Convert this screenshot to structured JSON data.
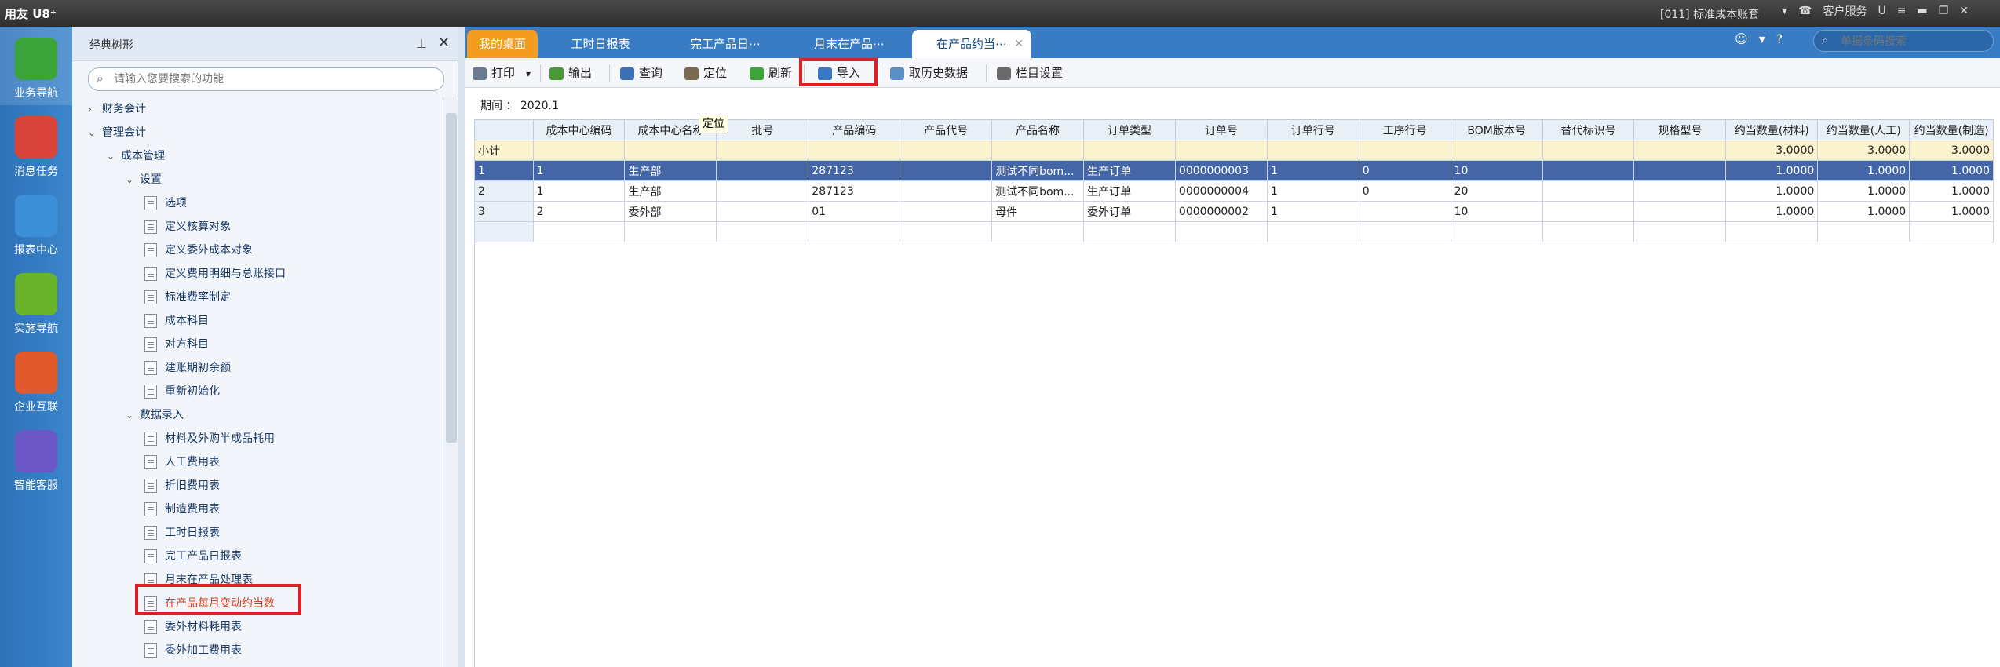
{
  "app": {
    "title": "用友 U8⁺"
  },
  "titlebar": {
    "account": "[011] 标准成本账套",
    "service": "客户服务",
    "u_icon": "U",
    "menu_icon": "≡",
    "min": "▬",
    "restore": "❐",
    "close": "✕"
  },
  "leftnav": [
    {
      "label": "业务导航",
      "icon": "business-nav-icon",
      "color": "#3aa33a"
    },
    {
      "label": "消息任务",
      "icon": "message-task-icon",
      "color": "#d9453a"
    },
    {
      "label": "报表中心",
      "icon": "report-center-icon",
      "color": "#3d8fd8"
    },
    {
      "label": "实施导航",
      "icon": "implement-nav-icon",
      "color": "#6ab42c"
    },
    {
      "label": "企业互联",
      "icon": "enterprise-link-icon",
      "color": "#e15a2c"
    },
    {
      "label": "智能客服",
      "icon": "smart-service-icon",
      "color": "#6b57c6"
    }
  ],
  "tree": {
    "title": "经典树形",
    "pin": "📌",
    "close": "✕",
    "search_placeholder": "请输入您要搜索的功能",
    "items": [
      {
        "label": "财务会计",
        "level": 0,
        "caret": "›"
      },
      {
        "label": "管理会计",
        "level": 0,
        "caret": "⌄"
      },
      {
        "label": "成本管理",
        "level": 1,
        "caret": "⌄"
      },
      {
        "label": "设置",
        "level": 2,
        "caret": "⌄"
      },
      {
        "label": "选项",
        "level": 3
      },
      {
        "label": "定义核算对象",
        "level": 3
      },
      {
        "label": "定义委外成本对象",
        "level": 3
      },
      {
        "label": "定义费用明细与总账接口",
        "level": 3
      },
      {
        "label": "标准费率制定",
        "level": 3
      },
      {
        "label": "成本科目",
        "level": 3
      },
      {
        "label": "对方科目",
        "level": 3
      },
      {
        "label": "建账期初余额",
        "level": 3
      },
      {
        "label": "重新初始化",
        "level": 3
      },
      {
        "label": "数据录入",
        "level": 2,
        "caret": "⌄"
      },
      {
        "label": "材料及外购半成品耗用",
        "level": 3
      },
      {
        "label": "人工费用表",
        "level": 3
      },
      {
        "label": "折旧费用表",
        "level": 3
      },
      {
        "label": "制造费用表",
        "level": 3
      },
      {
        "label": "工时日报表",
        "level": 3
      },
      {
        "label": "完工产品日报表",
        "level": 3
      },
      {
        "label": "月末在产品处理表",
        "level": 3
      },
      {
        "label": "在产品每月变动约当数",
        "level": 3,
        "selected": true
      },
      {
        "label": "委外材料耗用表",
        "level": 3
      },
      {
        "label": "委外加工费用表",
        "level": 3
      }
    ]
  },
  "tabs": [
    {
      "label": "我的桌面",
      "kind": "home"
    },
    {
      "label": "工时日报表",
      "kind": "normal"
    },
    {
      "label": "完工产品日⋯",
      "kind": "normal"
    },
    {
      "label": "月末在产品⋯",
      "kind": "normal"
    },
    {
      "label": "在产品约当⋯",
      "kind": "active",
      "close": "✕"
    }
  ],
  "topright": {
    "smile": "☺",
    "dropdown": "▾",
    "help": "?",
    "search_placeholder": "单据条码搜索"
  },
  "toolbar": [
    {
      "label": "打印",
      "icon": "print-icon",
      "color": "#6a7b8f",
      "arrow": "▾"
    },
    {
      "label": "输出",
      "icon": "export-icon",
      "color": "#4a9a3c"
    },
    {
      "label": "查询",
      "icon": "query-icon",
      "color": "#3b6fb8"
    },
    {
      "label": "定位",
      "icon": "locate-icon",
      "color": "#7a6a4f"
    },
    {
      "label": "刷新",
      "icon": "refresh-icon",
      "color": "#3da53a"
    },
    {
      "label": "导入",
      "icon": "import-icon",
      "color": "#3b78c4"
    },
    {
      "label": "取历史数据",
      "icon": "history-data-icon",
      "color": "#5a8ec6"
    },
    {
      "label": "栏目设置",
      "icon": "column-settings-icon",
      "color": "#6a6a6a"
    }
  ],
  "tooltip": "定位",
  "period": {
    "label": "期间 ： 2020.1"
  },
  "grid": {
    "columns": [
      "",
      "成本中心编码",
      "成本中心名称",
      "批号",
      "产品编码",
      "产品代号",
      "产品名称",
      "订单类型",
      "订单号",
      "订单行号",
      "工序行号",
      "BOM版本号",
      "替代标识号",
      "规格型号",
      "约当数量(材料)",
      "约当数量(人工)",
      "约当数量(制造)"
    ],
    "subtotal": [
      "小计",
      "",
      "",
      "",
      "",
      "",
      "",
      "",
      "",
      "",
      "",
      "",
      "",
      "",
      "3.0000",
      "3.0000",
      "3.0000"
    ],
    "rows": [
      [
        "1",
        "1",
        "生产部",
        "",
        "287123",
        "",
        "测试不同bom...",
        "生产订单",
        "0000000003",
        "1",
        "0",
        "10",
        "",
        "",
        "1.0000",
        "1.0000",
        "1.0000"
      ],
      [
        "2",
        "1",
        "生产部",
        "",
        "287123",
        "",
        "测试不同bom...",
        "生产订单",
        "0000000004",
        "1",
        "0",
        "20",
        "",
        "",
        "1.0000",
        "1.0000",
        "1.0000"
      ],
      [
        "3",
        "2",
        "委外部",
        "",
        "01",
        "",
        "母件",
        "委外订单",
        "0000000002",
        "1",
        "",
        "10",
        "",
        "",
        "1.0000",
        "1.0000",
        "1.0000"
      ]
    ],
    "selected_row": 0
  }
}
